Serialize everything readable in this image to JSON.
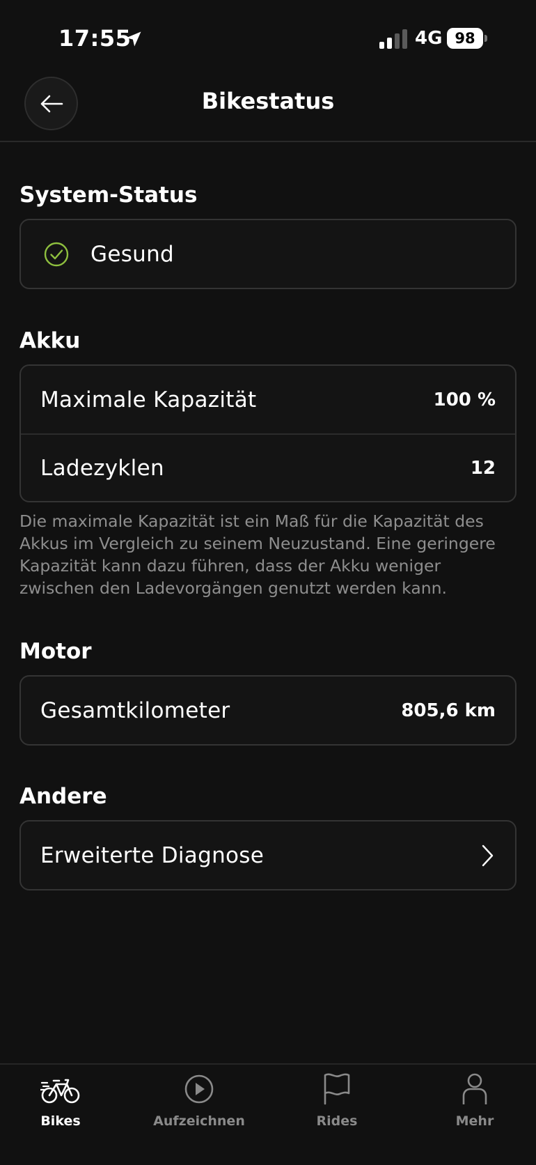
{
  "status_bar": {
    "time": "17:55",
    "network": "4G",
    "battery": "98",
    "location_icon": "location-arrow-icon",
    "signal_icon": "signal-bars-icon"
  },
  "nav": {
    "title": "Bikestatus",
    "back_icon": "arrow-left-icon"
  },
  "system_status": {
    "title": "System-Status",
    "status_label": "Gesund",
    "status_icon": "check-circle-icon",
    "status_color": "#8fc03f"
  },
  "battery": {
    "title": "Akku",
    "rows": [
      {
        "label": "Maximale Kapazität",
        "value": "100 %"
      },
      {
        "label": "Ladezyklen",
        "value": "12"
      }
    ],
    "note": "Die maximale Kapazität ist ein Maß für die Kapazität des Akkus im Vergleich zu seinem Neuzustand. Eine geringere Kapazität kann dazu führen, dass der Akku weniger zwischen den Ladevorgängen genutzt werden kann."
  },
  "motor": {
    "title": "Motor",
    "rows": [
      {
        "label": "Gesamtkilometer",
        "value": "805,6 km"
      }
    ]
  },
  "other": {
    "title": "Andere",
    "rows": [
      {
        "label": "Erweiterte Diagnose",
        "icon": "chevron-right-icon"
      }
    ]
  },
  "tabs": [
    {
      "label": "Bikes",
      "icon": "bike-icon",
      "active": true
    },
    {
      "label": "Aufzeichnen",
      "icon": "play-circle-icon",
      "active": false
    },
    {
      "label": "Rides",
      "icon": "flag-icon",
      "active": false
    },
    {
      "label": "Mehr",
      "icon": "person-icon",
      "active": false
    }
  ],
  "colors": {
    "background": "#111111",
    "card_border": "#343434",
    "text_secondary": "#8e8e8e",
    "success": "#8fc03f"
  }
}
